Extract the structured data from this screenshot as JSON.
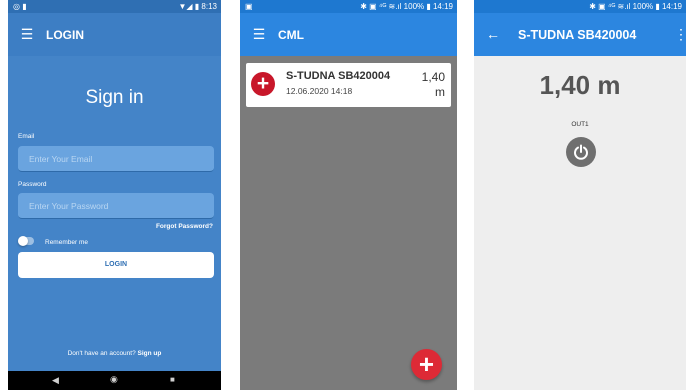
{
  "screen_login": {
    "status": {
      "left": "◎ ▮",
      "right": "▼◢ ▮ 8:13"
    },
    "appbar": {
      "menu_icon": "hamburger-icon",
      "title": "LOGIN"
    },
    "heading": "Sign in",
    "email": {
      "label": "Email",
      "placeholder": "Enter Your Email",
      "value": ""
    },
    "password": {
      "label": "Password",
      "placeholder": "Enter Your Password",
      "value": ""
    },
    "forgot_password": "Forgot Password?",
    "remember_me": {
      "label": "Remember me",
      "checked": false
    },
    "login_button": "LOGIN",
    "signup": {
      "prompt": "Don't have an account?",
      "link": "Sign up"
    },
    "navbar": {
      "back": "◀",
      "home": "◉",
      "recent": "■"
    },
    "colors": {
      "background": "#4484c8",
      "appbar": "#3d7ec4"
    }
  },
  "screen_list": {
    "status": {
      "left": "▣",
      "right": "✱ ▣ ⁴ᴳ ≋.ıl 100% ▮ 14:19"
    },
    "appbar": {
      "menu_icon": "hamburger-icon",
      "title": "CML"
    },
    "device": {
      "icon": "add-circle-icon",
      "name": "S-TUDNA SB420004",
      "date": "12.06.2020 14:18",
      "value": "1,40",
      "unit": "m"
    },
    "fab_icon": "add-icon",
    "colors": {
      "background": "#7b7b7b",
      "appbar": "#2c86e0",
      "accent": "#c8172a"
    }
  },
  "screen_detail": {
    "status": {
      "right": "✱ ▣ ⁴ᴳ ≋.ıl 100% ▮ 14:19"
    },
    "appbar": {
      "back_icon": "arrow-back-icon",
      "title": "S-TUDNA SB420004",
      "more_icon": "more-vert-icon"
    },
    "value_display": "1,40 m",
    "output_label": "OUT1",
    "power_icon": "power-icon",
    "colors": {
      "background": "#eeeeee",
      "appbar": "#2c86e0"
    }
  }
}
